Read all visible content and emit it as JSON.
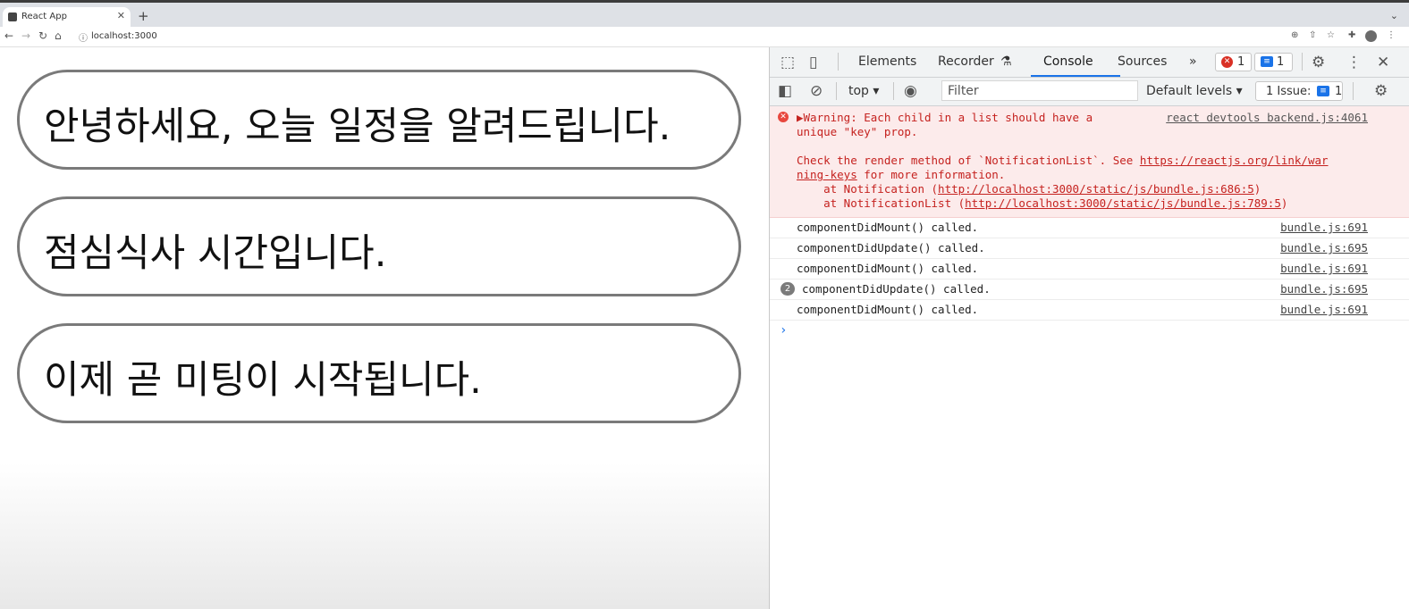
{
  "browser": {
    "tab_title": "React App",
    "tab_close": "✕",
    "new_tab": "+",
    "url": "localhost:3000"
  },
  "page": {
    "notifications": [
      {
        "message": "안녕하세요, 오늘 일정을 알려드립니다."
      },
      {
        "message": "점심식사 시간입니다."
      },
      {
        "message": "이제 곧 미팅이 시작됩니다."
      }
    ]
  },
  "devtools": {
    "tabs": [
      "Elements",
      "Recorder",
      "Console",
      "Sources"
    ],
    "active_tab": "Console",
    "more_tabs": "»",
    "error_count": "1",
    "info_count": "1",
    "context": "top",
    "filter_placeholder": "Filter",
    "levels": "Default levels",
    "issues_label": "1 Issue:",
    "issues_count": "1"
  },
  "console": {
    "warning": {
      "line1": "▶Warning: Each child in a list should have a",
      "line2": "unique \"key\" prop.",
      "line3_pre": "Check the render method of `NotificationList`. See ",
      "line3_link": "https://reactjs.org/link/war",
      "line4_link": "ning-keys",
      "line4_post": " for more information.",
      "line5_pre": "    at Notification (",
      "line5_link": "http://localhost:3000/static/js/bundle.js:686:5",
      "line5_post": ")",
      "line6_pre": "    at NotificationList (",
      "line6_link": "http://localhost:3000/static/js/bundle.js:789:5",
      "line6_post": ")",
      "source": "react devtools backend.js:4061"
    },
    "messages": [
      {
        "text": "componentDidMount() called.",
        "source": "bundle.js:691",
        "repeat": ""
      },
      {
        "text": "componentDidUpdate() called.",
        "source": "bundle.js:695",
        "repeat": ""
      },
      {
        "text": "componentDidMount() called.",
        "source": "bundle.js:691",
        "repeat": ""
      },
      {
        "text": "componentDidUpdate() called.",
        "source": "bundle.js:695",
        "repeat": "2"
      },
      {
        "text": "componentDidMount() called.",
        "source": "bundle.js:691",
        "repeat": ""
      }
    ],
    "prompt": "›"
  },
  "colors": {
    "accent": "#1a73e8",
    "error": "#c5221f",
    "warning_bg": "#fcebeb"
  }
}
